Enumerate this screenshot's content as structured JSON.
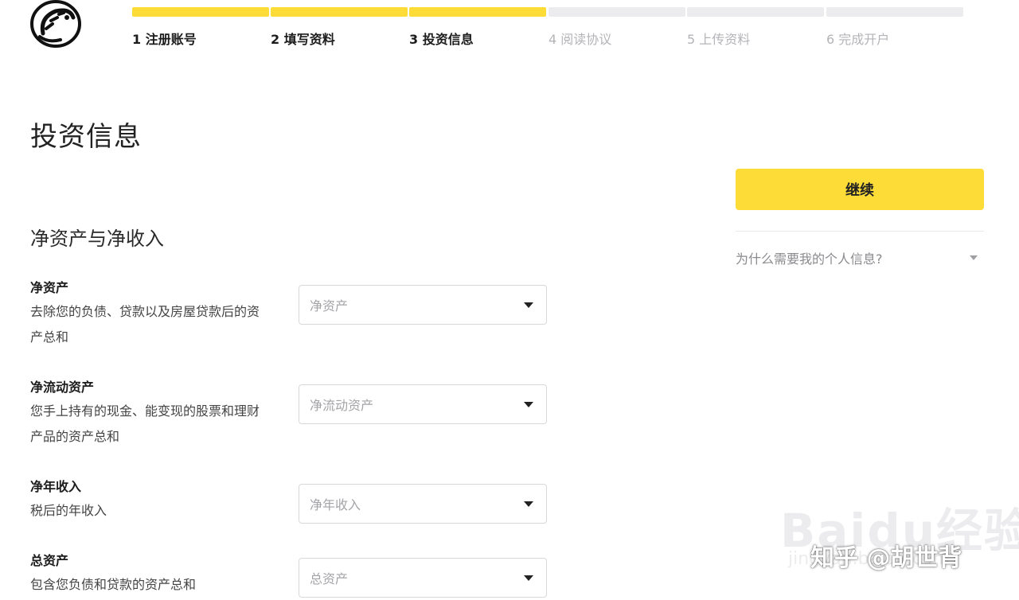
{
  "steps": [
    {
      "label": "1 注册账号",
      "active": true
    },
    {
      "label": "2 填写资料",
      "active": true
    },
    {
      "label": "3 投资信息",
      "active": true
    },
    {
      "label": "4 阅读协议",
      "active": false
    },
    {
      "label": "5 上传资料",
      "active": false
    },
    {
      "label": "6 完成开户",
      "active": false
    }
  ],
  "page": {
    "title": "投资信息"
  },
  "sidebar": {
    "continue_label": "继续",
    "why_text": "为什么需要我的个人信息?"
  },
  "section": {
    "title": "净资产与净收入"
  },
  "fields": [
    {
      "label": "净资产",
      "desc": "去除您的负债、贷款以及房屋贷款后的资产总和",
      "placeholder": "净资产"
    },
    {
      "label": "净流动资产",
      "desc": "您手上持有的现金、能变现的股票和理财产品的资产总和",
      "placeholder": "净流动资产"
    },
    {
      "label": "净年收入",
      "desc": "税后的年收入",
      "placeholder": "净年收入"
    },
    {
      "label": "总资产",
      "desc": "包含您负债和贷款的资产总和",
      "placeholder": "总资产"
    }
  ],
  "watermarks": {
    "baidu": "Baidu经验",
    "baidu_sub": "jingyan.baidu.com",
    "zhihu": "知乎 @胡世背"
  },
  "colors": {
    "accent": "#fddc38",
    "inactive": "#ececef"
  }
}
